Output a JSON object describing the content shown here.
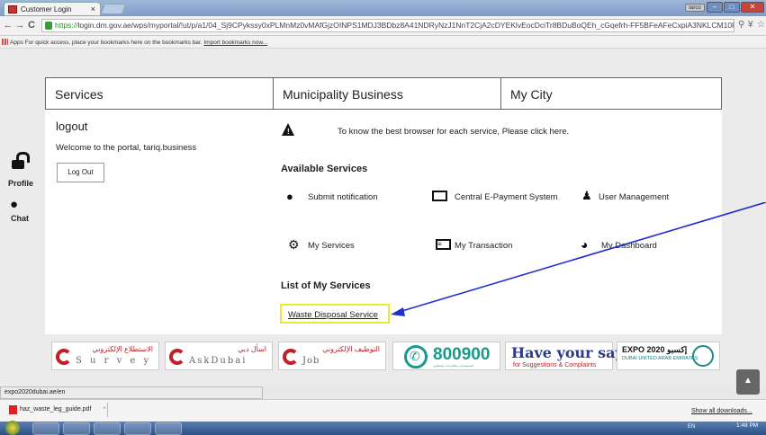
{
  "browser": {
    "tab_title": "Customer Login",
    "tab_close": "×",
    "user_button": "tarco",
    "window_controls": {
      "minimize": "–",
      "maximize": "□",
      "close": "✕"
    },
    "nav": {
      "back": "←",
      "forward": "→",
      "reload": "C"
    },
    "url_scheme": "https://",
    "url_rest": "login.dm.gov.ae/wps/myportal/!ut/p/a1/04_Sj9CPykssy0xPLMnMz0vMAfGjzOINPS1MDJ3BDbz8A41NDRyNzJ1NnT2CjA2cDYEKlvEocDciTr8BDuBoQEh_cGqefrh-FF5BFeAFeCxpiA3NKLCM10R/",
    "bookmarks_apps": "Apps",
    "bookmarks_text": "For quick access, place your bookmarks here on the bookmarks bar.",
    "bookmarks_link": "Import bookmarks now...",
    "status_url": "expo2020dubai.ae/en"
  },
  "topnav": {
    "services": "Services",
    "municipality_business": "Municipality Business",
    "my_city": "My City"
  },
  "left_panel": {
    "logout_title": "logout",
    "welcome": "Welcome to the portal, tariq.business",
    "logout_button": "Log Out"
  },
  "notice": {
    "text": "To know the best browser for each service, Please click here."
  },
  "available": {
    "title": "Available Services",
    "items": [
      {
        "label": "Submit notification",
        "icon": "comments-icon"
      },
      {
        "label": "Central E-Payment System",
        "icon": "credit-card-icon"
      },
      {
        "label": "User Management",
        "icon": "user-icon"
      },
      {
        "label": "My Services",
        "icon": "cogs-icon"
      },
      {
        "label": "My Transaction",
        "icon": "list-icon"
      },
      {
        "label": "My Dashboard",
        "icon": "dashboard-icon"
      }
    ]
  },
  "my_services": {
    "title": "List of My Services",
    "waste": "Waste Disposal Service"
  },
  "side_tools": {
    "profile": "Profile",
    "chat": "Chat"
  },
  "banners": {
    "survey_ar": "الاستطلاع الإلكتروني",
    "survey_en": "S u r v e y",
    "askdubai_ar": "اسأل دبي",
    "askdubai_en": "AskDubai",
    "job_ar": "التوظيف الإلكتروني",
    "job_en": "Job",
    "phone": "800900",
    "phone_small": "للاستفسارات والاقتراحات والشكاوى",
    "have_your_say": "Have your say.",
    "suggestions": "for Suggestions & Complaints",
    "expo": "EXPO 2020 إكسبو",
    "expo_sub": "DUBAI UNITED ARAB EMIRATES"
  },
  "downloads": {
    "file": "haz_waste_leg_guide.pdf",
    "show_all": "Show all downloads..."
  },
  "taskbar": {
    "tray": "EN",
    "time": "1:48 PM"
  }
}
